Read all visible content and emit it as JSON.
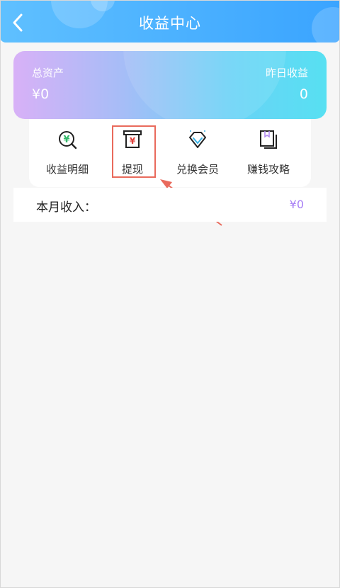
{
  "header": {
    "title": "收益中心"
  },
  "assets": {
    "total_label": "总资产",
    "total_value": "¥0",
    "yesterday_label": "昨日收益",
    "yesterday_value": "0"
  },
  "menu": {
    "items": [
      {
        "label": "收益明细",
        "icon": "income-detail-icon"
      },
      {
        "label": "提现",
        "icon": "withdraw-icon"
      },
      {
        "label": "兑换会员",
        "icon": "diamond-icon"
      },
      {
        "label": "赚钱攻略",
        "icon": "book-icon"
      }
    ]
  },
  "income": {
    "label": "本月收入：",
    "value": "¥0"
  },
  "colors": {
    "header": "#3aa4ff",
    "card_gradient_start": "#d8b1f7",
    "card_gradient_end": "#57e0f2",
    "income_value": "#a77ef5",
    "annotation": "#e96a5c"
  }
}
